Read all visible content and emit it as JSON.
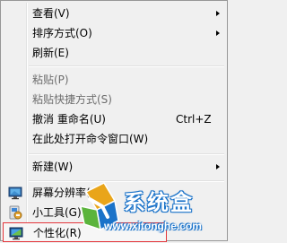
{
  "menu": {
    "items": [
      {
        "label": "查看(V)",
        "submenu": true
      },
      {
        "label": "排序方式(O)",
        "submenu": true
      },
      {
        "label": "刷新(E)"
      },
      {
        "label": "粘贴(P)",
        "disabled": true
      },
      {
        "label": "粘贴快捷方式(S)",
        "disabled": true
      },
      {
        "label": "撤消 重命名(U)",
        "shortcut": "Ctrl+Z"
      },
      {
        "label": "在此处打开命令窗口(W)"
      },
      {
        "label": "新建(W)",
        "submenu": true
      },
      {
        "label": "屏幕分辨率(C)",
        "icon": "screen-resolution-icon"
      },
      {
        "label": "小工具(G)",
        "icon": "gadgets-icon"
      },
      {
        "label": "个性化(R)",
        "icon": "personalize-icon",
        "highlighted": true
      }
    ]
  },
  "watermark": {
    "brand": "系统盒",
    "url": "www.xitonghe.com",
    "colors": {
      "primary": "#1b73c9",
      "accent": "#e9a51a",
      "green": "#5bb43c"
    }
  }
}
